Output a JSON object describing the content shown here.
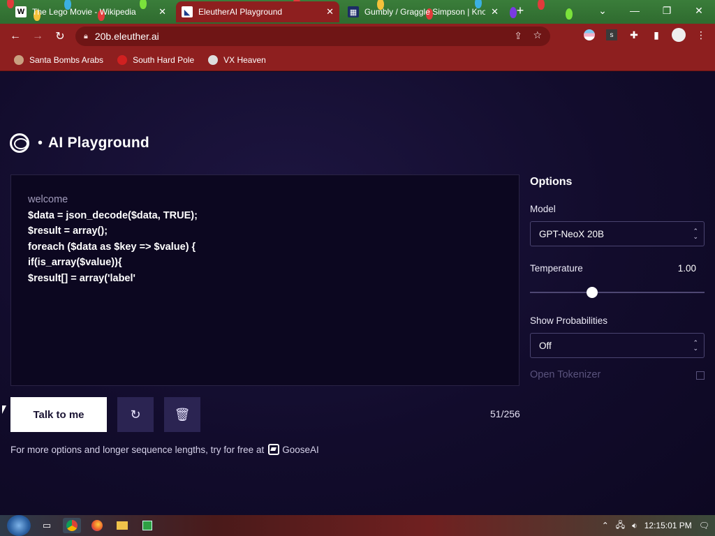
{
  "browser": {
    "tabs": [
      {
        "title": "The Lego Movie - Wikipedia",
        "favicon": "W",
        "active": false
      },
      {
        "title": "EleutherAI Playground",
        "favicon": "",
        "active": true
      },
      {
        "title": "Gumbly / Graggle Simpson | Kno",
        "favicon": "",
        "active": false
      }
    ],
    "new_tab_label": "+",
    "url": "20b.eleuther.ai",
    "bookmarks": [
      {
        "label": "Santa Bombs Arabs"
      },
      {
        "label": "South Hard Pole"
      },
      {
        "label": "VX Heaven"
      }
    ],
    "accent_color": "#8e1f1f"
  },
  "app": {
    "brand_title": "AI Playground",
    "brand_separator": "•",
    "editor": {
      "prompt_line": "welcome",
      "lines": [
        "$data = json_decode($data, TRUE);",
        "$result = array();",
        "foreach ($data as $key => $value) {",
        "if(is_array($value)){",
        "$result[] = array('label'"
      ]
    },
    "talk_button_label": "Talk to me",
    "token_counter": "51/256",
    "footnote_text": "For more options and longer sequence lengths, try for free at",
    "footnote_link": "GooseAI",
    "options": {
      "title": "Options",
      "model_label": "Model",
      "model_value": "GPT-NeoX 20B",
      "temperature_label": "Temperature",
      "temperature_value": "1.00",
      "temperature_fraction": 0.345,
      "show_prob_label": "Show Probabilities",
      "show_prob_value": "Off",
      "tokenizer_label": "Open Tokenizer"
    }
  },
  "taskbar": {
    "clock": "12:15:01 PM"
  }
}
